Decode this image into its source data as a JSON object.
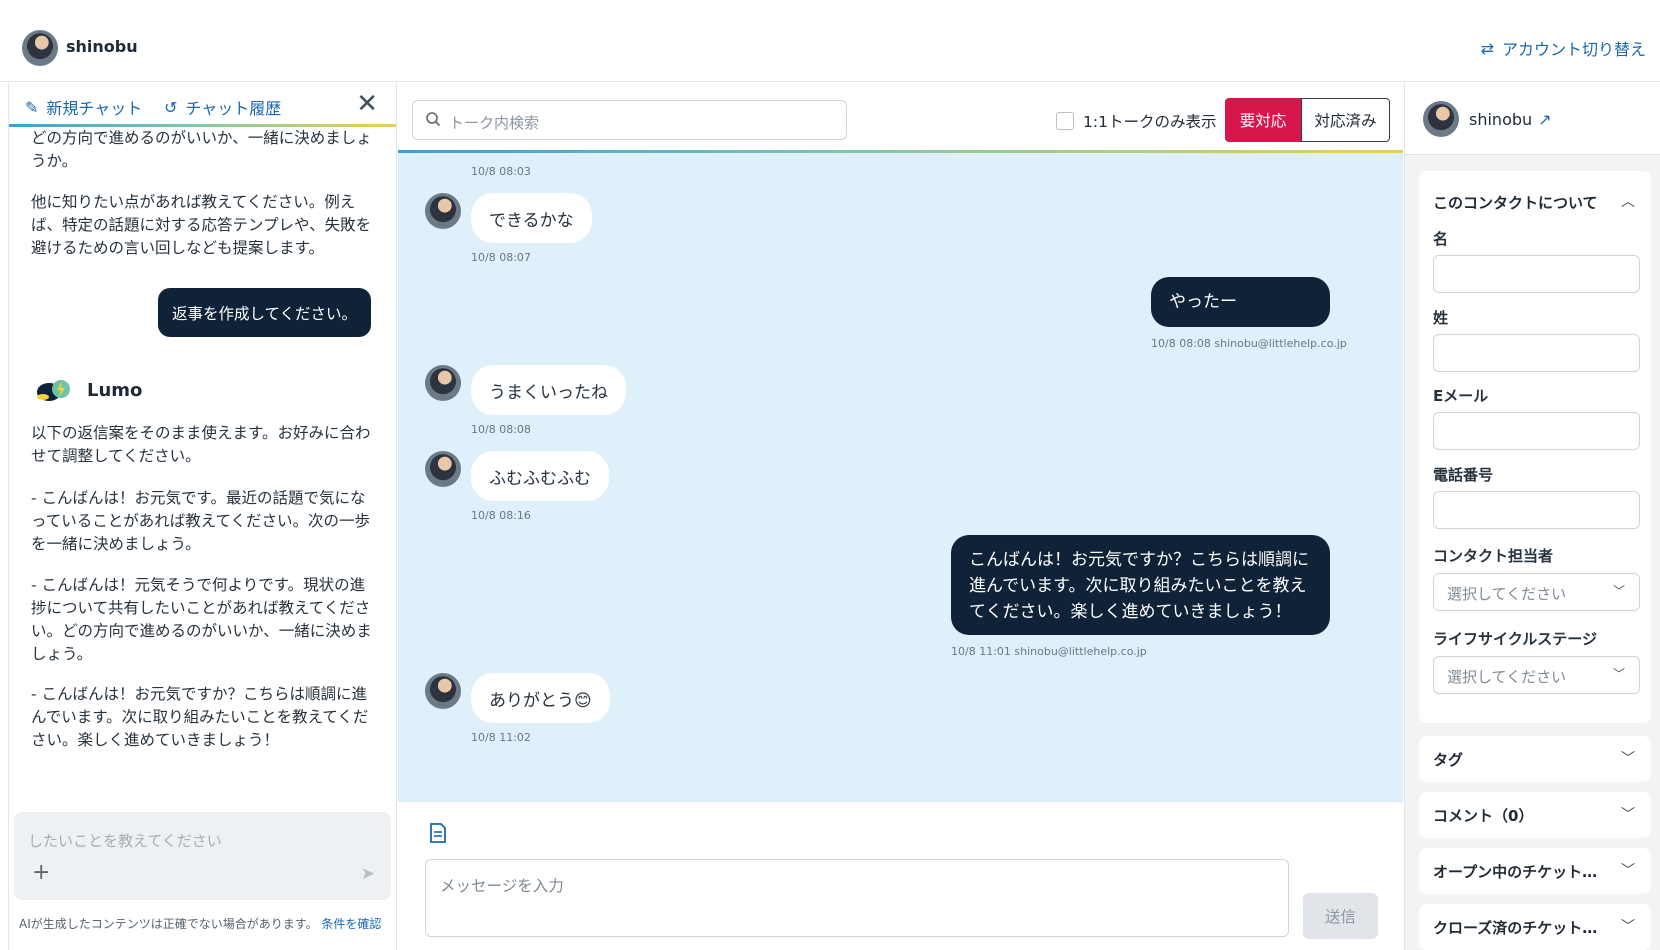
{
  "topbar": {
    "username": "shinobu",
    "switch_account": "アカウント切り替え"
  },
  "left_panel": {
    "tab_new": "新規チャット",
    "tab_history": "チャット履歴",
    "ai_text_top": "どの方向で進めるのがいいか、一緒に決めましょうか。",
    "ai_text_2": "他に知りたい点があれば教えてください。例えば、特定の話題に対する応答テンプレや、失敗を避けるための言い回しなども提案します。",
    "user_request": "返事を作成してください。",
    "bot_name": "Lumo",
    "ai_reply_intro": "以下の返信案をそのまま使えます。お好みに合わせて調整してください。",
    "ai_reply_1": "- こんばんは！お元気です。最近の話題で気になっていることがあれば教えてください。次の一歩を一緒に決めましょう。",
    "ai_reply_2": "- こんばんは！元気そうで何よりです。現状の進捗について共有したいことがあれば教えてください。どの方向で進めるのがいいか、一緒に決めましょう。",
    "ai_reply_3": "- こんばんは！お元気ですか？こちらは順調に進んでいます。次に取り組みたいことを教えてください。楽しく進めていきましょう！",
    "prompt_placeholder": "したいことを教えてください",
    "disclaimer": "AIが生成したコンテンツは正確でない場合があります。",
    "terms_link": "条件を確認"
  },
  "center": {
    "search_placeholder": "トーク内検索",
    "only_1to1": "1:1トークのみ表示",
    "btn_needs_action": "要対応",
    "btn_done": "対応済み",
    "messages": [
      {
        "text": "",
        "time": "10/8 08:03"
      },
      {
        "text": "できるかな",
        "time": "10/8 08:07"
      },
      {
        "text": "やったー",
        "time": "10/8 08:08 shinobu@littlehelp.co.jp"
      },
      {
        "text": "うまくいったね",
        "time": "10/8 08:08"
      },
      {
        "text": "ふむふむふむ",
        "time": "10/8 08:16"
      },
      {
        "text": "こんばんは！お元気ですか？こちらは順調に進んでいます。次に取り組みたいことを教えてください。楽しく進めていきましょう！",
        "time": "10/8 11:01 shinobu@littlehelp.co.jp"
      },
      {
        "text": "ありがとう😊",
        "time": "10/8 11:02"
      }
    ],
    "composer_placeholder": "メッセージを入力",
    "send": "送信"
  },
  "right_panel": {
    "name": "shinobu",
    "about_title": "このコンタクトについて",
    "first_name": "名",
    "last_name": "姓",
    "email": "Eメール",
    "phone": "電話番号",
    "owner": "コンタクト担当者",
    "owner_value": "選択してください",
    "lifecycle": "ライフサイクルステージ",
    "lifecycle_value": "選択してください",
    "tags": "タグ",
    "comments": "コメント（0）",
    "open_tickets": "オープン中のチケット…",
    "closed_tickets": "クローズ済のチケット…"
  },
  "colors": {
    "accent": "#1b67b2",
    "dark_bubble": "#0f2238",
    "alert": "#d6174b",
    "chat_bg": "#dff0fa"
  }
}
